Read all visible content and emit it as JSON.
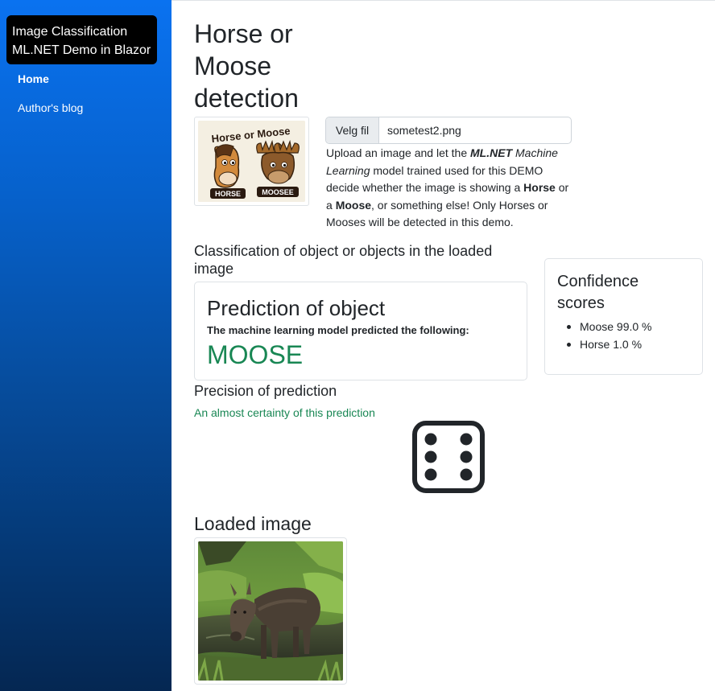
{
  "sidebar": {
    "brand_line1": "Image Classification",
    "brand_line2": "ML.NET Demo in Blazor",
    "nav": [
      {
        "label": "Home",
        "active": true
      },
      {
        "label": "Author's blog",
        "active": false
      }
    ]
  },
  "main": {
    "title": "Horse or Moose detection",
    "logo": {
      "text_line1": "Horse or Moose",
      "tag_left": "HORSE",
      "tag_right": "MOOSEE"
    },
    "file_input": {
      "button_label": "Velg fil",
      "file_name": "sometest2.png"
    },
    "intro": {
      "t1": "Upload an image and let the ",
      "b1": "ML.NET",
      "i1": " Machine Learning",
      "t2": " model trained used for this DEMO decide whether the image is showing a ",
      "b2": "Horse",
      "t3": " or a ",
      "b3": "Moose",
      "t4": ", or something else! Only Horses or Mooses will be detected in this demo."
    },
    "classification_heading": "Classification of object or objects in the loaded image",
    "prediction_card": {
      "title": "Prediction of object",
      "subtitle": "The machine learning model predicted the following:",
      "value": "MOOSE"
    },
    "confidence_card": {
      "title": "Confidence scores",
      "items": [
        "Moose 99.0 %",
        "Horse 1.0 %"
      ]
    },
    "precision_heading": "Precision of prediction",
    "precision_text": "An almost certainty of this prediction",
    "dice_icon": "dice-six-icon",
    "loaded_heading": "Loaded image"
  },
  "colors": {
    "sidebar_top": "#0a72f0",
    "sidebar_bottom": "#052752",
    "success": "#198754",
    "text": "#212529"
  }
}
